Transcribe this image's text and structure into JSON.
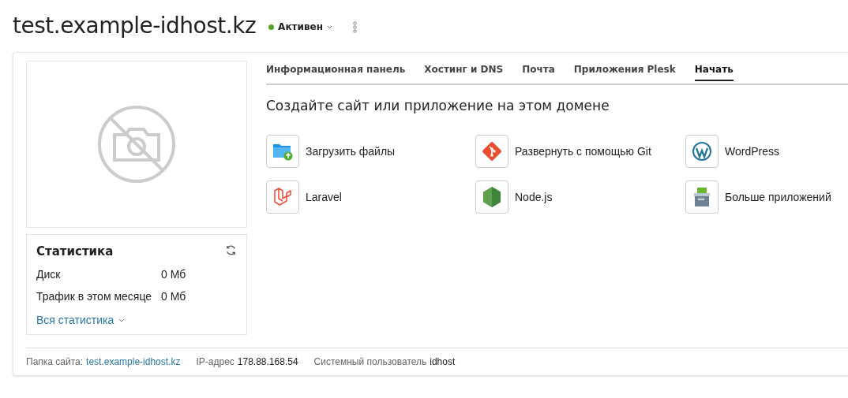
{
  "domain": {
    "title": "test.example-idhost.kz",
    "status": "Активен"
  },
  "tabs": [
    {
      "label": "Информационная панель",
      "selected": false
    },
    {
      "label": "Хостинг и DNS",
      "selected": false
    },
    {
      "label": "Почта",
      "selected": false
    },
    {
      "label": "Приложения Plesk",
      "selected": false
    },
    {
      "label": "Начать",
      "selected": true
    }
  ],
  "start": {
    "heading": "Создайте сайт или приложение на этом домене",
    "apps": [
      {
        "kind": "upload",
        "label": "Загрузить файлы"
      },
      {
        "kind": "git",
        "label": "Развернуть с помощью Git"
      },
      {
        "kind": "wordpress",
        "label": "WordPress"
      },
      {
        "kind": "laravel",
        "label": "Laravel"
      },
      {
        "kind": "node",
        "label": "Node.js"
      },
      {
        "kind": "more",
        "label": "Больше приложений"
      }
    ]
  },
  "statistics": {
    "title": "Статистика",
    "rows": [
      {
        "label": "Диск",
        "value": "0 Мб"
      },
      {
        "label": "Трафик в этом месяце",
        "value": "0 Мб"
      }
    ],
    "link": "Вся статистика"
  },
  "footer": [
    {
      "label": "Папка сайта:",
      "value": "test.example-idhost.kz",
      "kind": "link"
    },
    {
      "label": "IP-адрес",
      "value": "178.88.168.54",
      "kind": "plain"
    },
    {
      "label": "Системный пользователь",
      "value": "idhost",
      "kind": "plain"
    }
  ]
}
